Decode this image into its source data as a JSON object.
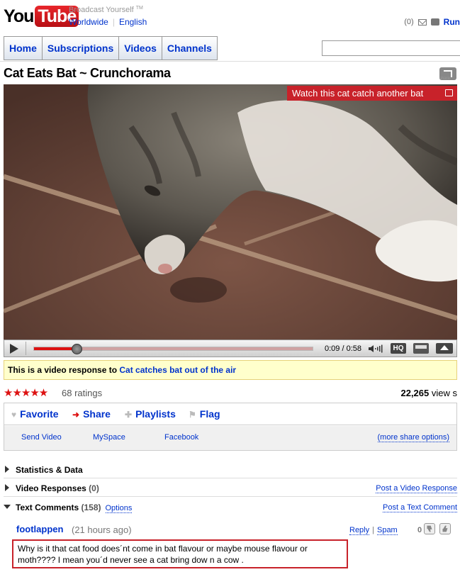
{
  "logo": {
    "you": "You",
    "tube": "Tube"
  },
  "masthead": {
    "tagline": "Broadcast Yourself",
    "tm": "TM",
    "worldwide": "Worldwide",
    "language": "English",
    "inbox_count": "(0)",
    "run_label": "Run"
  },
  "nav": {
    "items": [
      "Home",
      "Subscriptions",
      "Videos",
      "Channels"
    ]
  },
  "search": {
    "value": ""
  },
  "video": {
    "title": "Cat Eats Bat ~ Crunchorama",
    "popout_label": "share",
    "annotation": "Watch this cat catch another bat",
    "time": "0:09 / 0:58",
    "progress_fraction": 0.155,
    "hq_label": "HQ"
  },
  "response": {
    "prefix": "This is a video response to",
    "link": "Cat catches bat out of the air"
  },
  "stats": {
    "stars": "★★★★★",
    "ratings": "68 ratings",
    "views_num": "22,265",
    "views_label": "view s"
  },
  "actions": {
    "tabs": [
      {
        "icon": "♥",
        "label": "Favorite"
      },
      {
        "icon": "➜",
        "label": "Share"
      },
      {
        "icon": "✚",
        "label": "Playlists"
      },
      {
        "icon": "⚑",
        "label": "Flag"
      }
    ],
    "share_links": [
      "Send Video",
      "MySpace",
      "Facebook"
    ],
    "more_share": "(more share options)"
  },
  "sections": {
    "statistics": "Statistics & Data",
    "video_responses": "Video Responses",
    "video_responses_count": "(0)",
    "post_video_response": "Post a Video Response",
    "text_comments": "Text Comments",
    "text_comments_count": "(158)",
    "options": "Options",
    "post_text_comment": "Post a Text Comment"
  },
  "comment": {
    "author": "footlappen",
    "time": "(21 hours ago)",
    "reply": "Reply",
    "spam": "Spam",
    "score": "0",
    "text": "Why is it that cat food does´nt come in bat flavour or maybe mouse flavour or moth???? I mean you´d never see a cat bring dow n a cow ."
  }
}
